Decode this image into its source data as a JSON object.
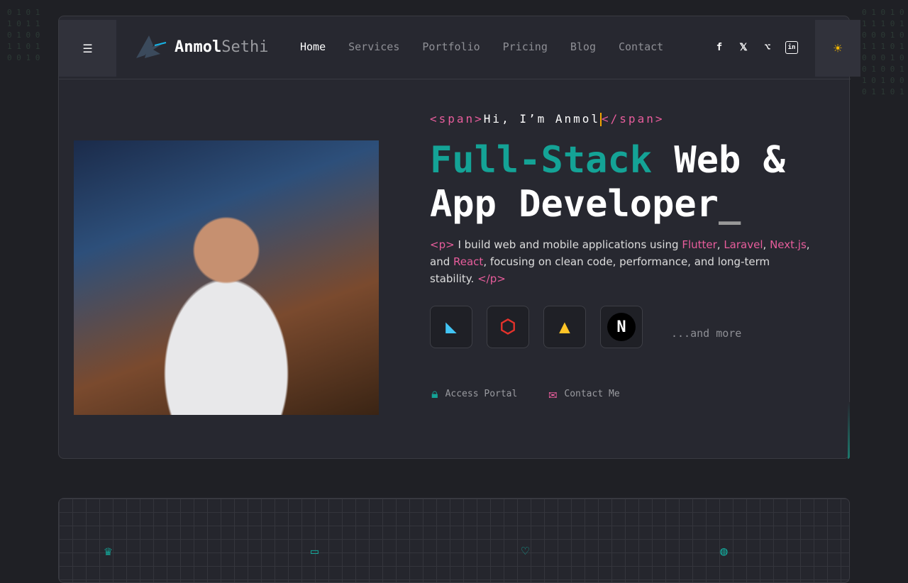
{
  "nav": {
    "logo_main": "Anmol",
    "logo_dim": "Sethi",
    "links": [
      "Home",
      "Services",
      "Portfolio",
      "Pricing",
      "Blog",
      "Contact"
    ],
    "social": [
      "facebook-icon",
      "x-icon",
      "github-icon",
      "linkedin-icon"
    ]
  },
  "hero": {
    "span_open": "<span>",
    "greeting": "Hi, I’m Anmol",
    "span_close": "</span>",
    "title_accent": "Full-Stack",
    "title_rest": " Web & App Developer",
    "title_cursor": "_",
    "p_open": "<p>",
    "desc_1": " I build web and mobile applications using ",
    "flutter": "Flutter",
    "comma1": ", ",
    "laravel": "Laravel",
    "comma2": ", ",
    "nextjs": "Next.js",
    "and": ", and ",
    "react": "React",
    "desc_2": ", focusing on clean code, performance, and long-term stability. ",
    "p_close": "</p>",
    "techs": [
      "Flutter",
      "Laravel",
      "Firebase",
      "Next.js"
    ],
    "more": "...and more",
    "access_portal": "Access Portal",
    "contact_me": "Contact Me"
  },
  "colors": {
    "accent": "#14a396",
    "pink": "#e85d9c",
    "bg": "#272830"
  }
}
